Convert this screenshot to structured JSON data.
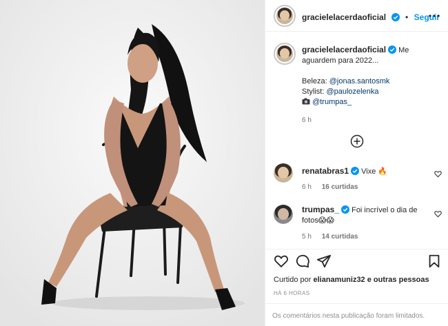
{
  "post": {
    "image_alt": "photo",
    "author": {
      "username": "gracielelacerdaoficial",
      "verified": true
    },
    "header_separator": "•",
    "follow_label": "Seguir",
    "more_icon": "more-horizontal-icon",
    "caption": {
      "username": "gracielelacerdaoficial",
      "line1": "Me aguardem para 2022...",
      "beauty_label": "Beleza:",
      "beauty_mention": "@jonas.santosmk",
      "stylist_label": "Stylist:",
      "stylist_mention": "@paulozelenka",
      "camera_icon": "camera-icon",
      "camera_mention": "@trumpas_",
      "time": "6 h"
    },
    "load_more_icon": "plus-circle-icon",
    "comments": [
      {
        "username": "renatabras1",
        "verified": true,
        "text": "Vixe 🔥",
        "time": "6 h",
        "likes": "16 curtidas"
      },
      {
        "username": "trumpas_",
        "verified": true,
        "text": "Foi incrível o dia de fotos😱😱",
        "time": "5 h",
        "likes": "14 curtidas"
      }
    ],
    "actions": {
      "like_icon": "heart-icon",
      "comment_icon": "comment-icon",
      "share_icon": "send-icon",
      "save_icon": "bookmark-icon"
    },
    "liked_by_prefix": "Curtido por",
    "liked_by_user": "elianamuniz32",
    "liked_by_suffix": "e outras pessoas",
    "timestamp": "HÁ 6 HORAS",
    "comments_limited": "Os comentários nesta publicação foram limitados."
  }
}
